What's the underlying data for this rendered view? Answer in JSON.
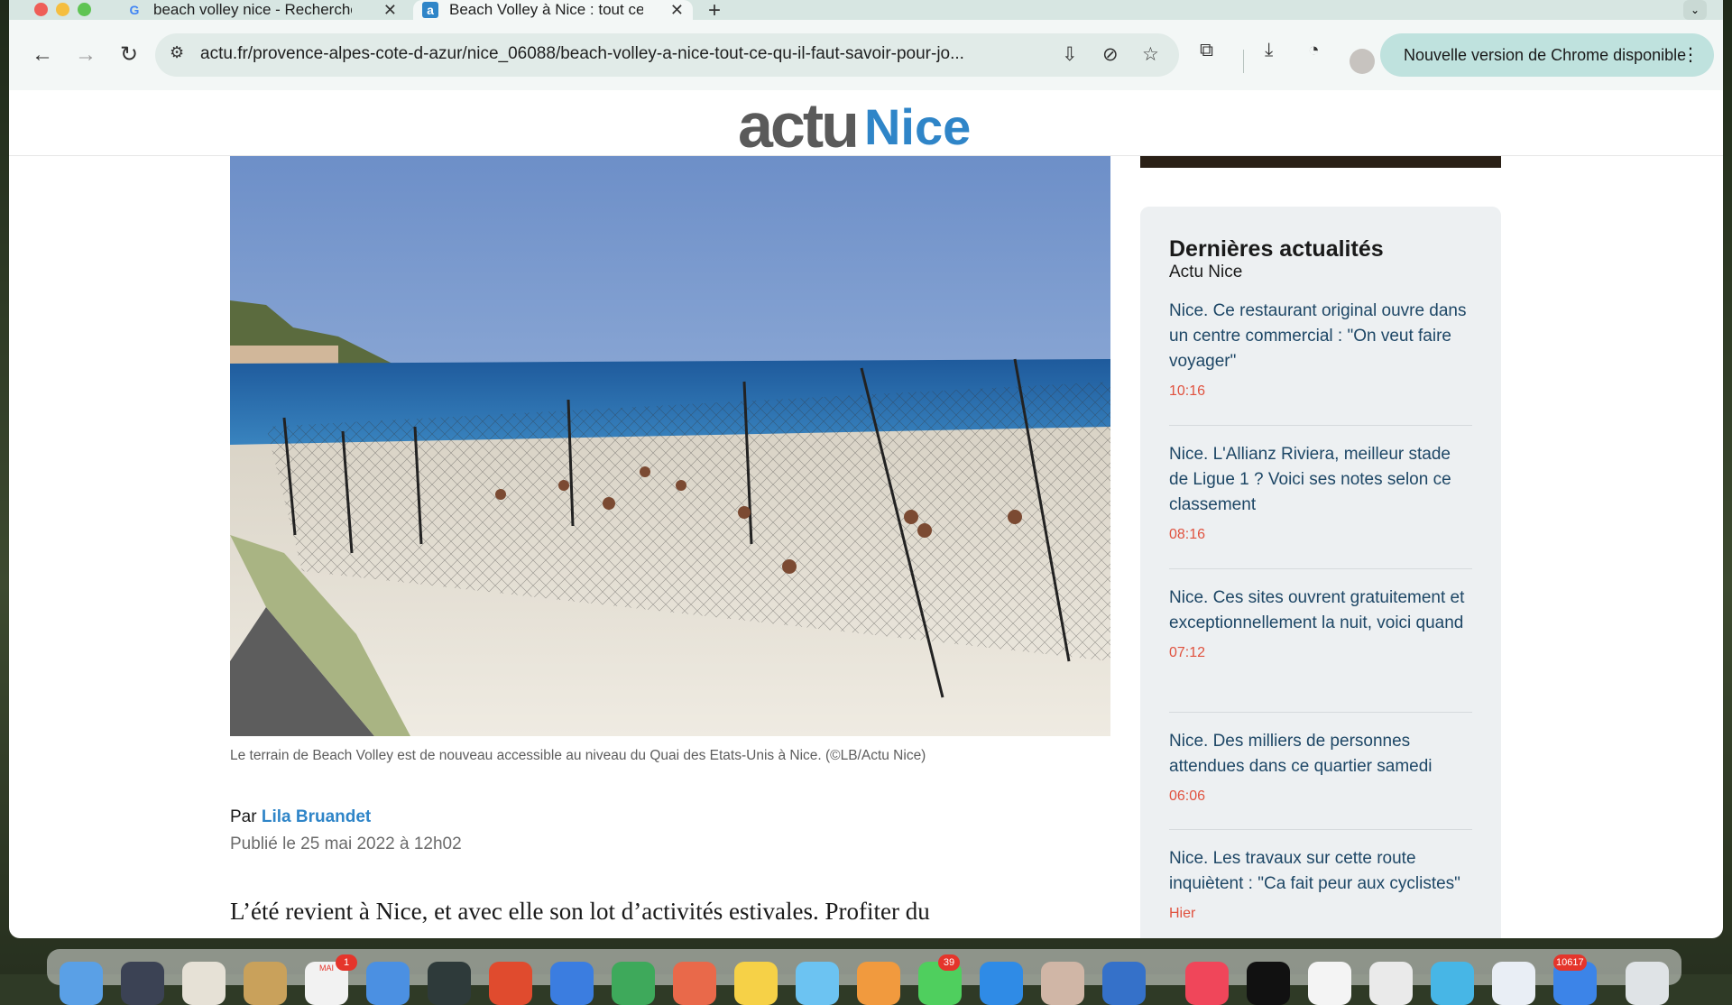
{
  "browser": {
    "tabs": [
      {
        "title": "beach volley nice - Recherche",
        "favicon": "google-icon",
        "active": false
      },
      {
        "title": "Beach Volley à Nice : tout ce qu'il faut savoir",
        "favicon": "actu-icon",
        "active": true
      }
    ],
    "url": "actu.fr/provence-alpes-cote-d-azur/nice_06088/beach-volley-a-nice-tout-ce-qu-il-faut-savoir-pour-jo...",
    "update_button": "Nouvelle version de Chrome disponible"
  },
  "site": {
    "logo_part1": "actu",
    "logo_part2": "Nice",
    "logo_colors": {
      "actu": "#5a5a5a",
      "nice": "#2f85c8"
    }
  },
  "article": {
    "caption": "Le terrain de Beach Volley est de nouveau accessible au niveau du Quai des Etats-Unis à Nice. (©LB/Actu Nice)",
    "byline_prefix": "Par",
    "author": "Lila Bruandet",
    "published": "Publié le 25 mai 2022 à 12h02",
    "lead": "L’été revient à Nice, et avec elle son lot d’activités estivales. Profiter du"
  },
  "sidebar": {
    "title": "Dernières actualités",
    "subtitle": "Actu Nice",
    "items": [
      {
        "headline": "Nice. Ce restaurant original ouvre dans un centre commercial : \"On veut faire voyager\"",
        "time": "10:16"
      },
      {
        "headline": "Nice. L'Allianz Riviera, meilleur stade de Ligue 1 ? Voici ses notes selon ce classement",
        "time": "08:16"
      },
      {
        "headline": "Nice. Ces sites ouvrent gratuitement et exceptionnellement la nuit, voici quand",
        "time": "07:12"
      },
      {
        "headline": "Nice. Des milliers de personnes attendues dans ce quartier samedi",
        "time": "06:06"
      },
      {
        "headline": "Nice. Les travaux sur cette route inquiètent : \"Ca fait peur aux cyclistes\"",
        "time": "Hier"
      }
    ]
  },
  "dock": {
    "calendar_month": "MAI",
    "badges": [
      "1",
      "39",
      "10617"
    ]
  }
}
